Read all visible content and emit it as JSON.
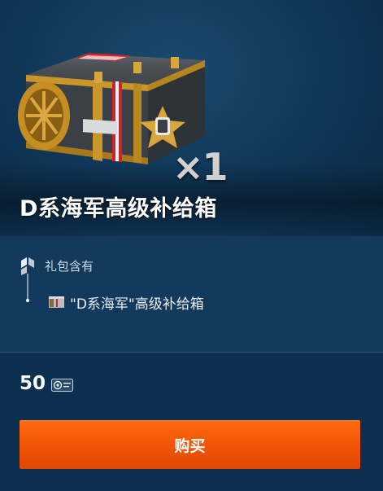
{
  "hero": {
    "multiplier": "×1",
    "title": "D系海军高级补给箱"
  },
  "contents": {
    "header": "礼包含有",
    "items": [
      {
        "label": "\"D系海军\"高级补给箱",
        "icon": "crate-icon"
      }
    ]
  },
  "purchase": {
    "price": "50",
    "currency_icon": "doubloon-icon",
    "buy_label": "购买",
    "button_color": "#f05a08"
  }
}
